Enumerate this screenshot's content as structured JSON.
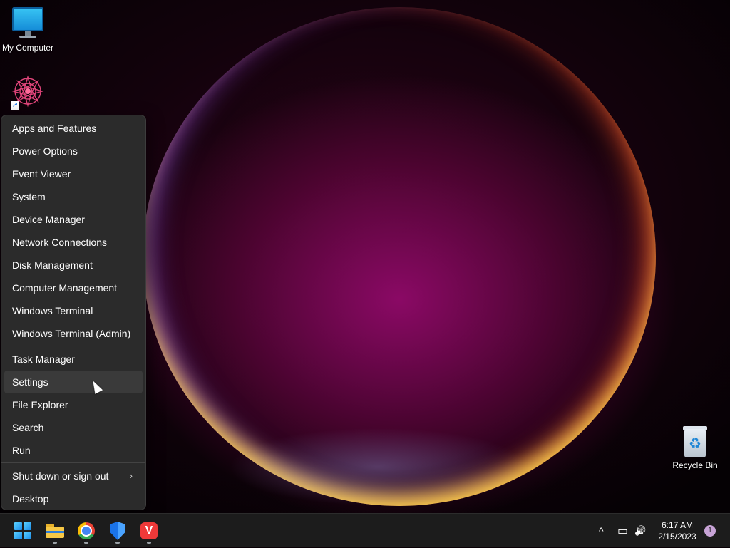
{
  "desktop": {
    "icons": [
      {
        "label": "My Computer",
        "icon": "monitor-icon"
      },
      {
        "label": "",
        "icon": "mandala-shortcut-icon"
      },
      {
        "label": "Recycle Bin",
        "icon": "recycle-bin-icon"
      }
    ]
  },
  "context_menu": {
    "groups": [
      [
        "Apps and Features",
        "Power Options",
        "Event Viewer",
        "System",
        "Device Manager",
        "Network Connections",
        "Disk Management",
        "Computer Management",
        "Windows Terminal",
        "Windows Terminal (Admin)"
      ],
      [
        "Task Manager",
        "Settings",
        "File Explorer",
        "Search",
        "Run"
      ],
      [
        "Shut down or sign out",
        "Desktop"
      ]
    ],
    "hovered_item": "Settings",
    "submenu_chevron": "›"
  },
  "taskbar": {
    "apps": [
      {
        "name": "Start",
        "icon": "windows-start-icon"
      },
      {
        "name": "File Explorer",
        "icon": "file-explorer-icon",
        "running": true
      },
      {
        "name": "Google Chrome",
        "icon": "chrome-icon",
        "running": true
      },
      {
        "name": "Windows Security",
        "icon": "windows-security-icon",
        "running": true
      },
      {
        "name": "Vivaldi",
        "icon": "vivaldi-icon",
        "running": true
      }
    ],
    "tray": {
      "overflow_glyph": "^",
      "network_glyph": "▭",
      "volume_glyph": "🔊",
      "time": "6:17 AM",
      "date": "2/15/2023",
      "notification_count": "1"
    }
  },
  "colors": {
    "menu_bg": "#2b2b2b",
    "menu_hover": "#3a3a3a",
    "taskbar_bg": "#1c1c1c",
    "accent": "#1a8ae8"
  }
}
